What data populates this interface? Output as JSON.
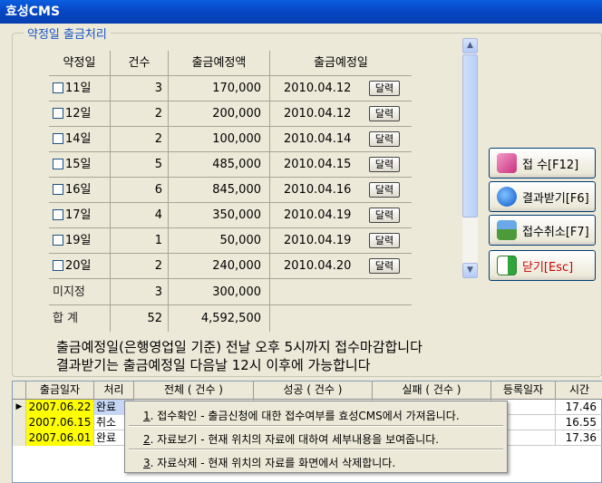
{
  "window": {
    "title": "효성CMS"
  },
  "group": {
    "title": "약정일 출금처리"
  },
  "grid": {
    "headers": [
      "약정일",
      "건수",
      "출금예정액",
      "출금예정일"
    ],
    "date_button_label": "달력",
    "rows": [
      {
        "day": "11일",
        "count": "3",
        "amount": "170,000",
        "date": "2010.04.12"
      },
      {
        "day": "12일",
        "count": "2",
        "amount": "200,000",
        "date": "2010.04.12"
      },
      {
        "day": "14일",
        "count": "2",
        "amount": "100,000",
        "date": "2010.04.14"
      },
      {
        "day": "15일",
        "count": "5",
        "amount": "485,000",
        "date": "2010.04.15"
      },
      {
        "day": "16일",
        "count": "6",
        "amount": "845,000",
        "date": "2010.04.16"
      },
      {
        "day": "17일",
        "count": "4",
        "amount": "350,000",
        "date": "2010.04.19"
      },
      {
        "day": "19일",
        "count": "1",
        "amount": "50,000",
        "date": "2010.04.19"
      },
      {
        "day": "20일",
        "count": "2",
        "amount": "240,000",
        "date": "2010.04.20"
      }
    ],
    "undesignated": {
      "label": "미지정",
      "count": "3",
      "amount": "300,000"
    },
    "total": {
      "label": "합 계",
      "count": "52",
      "amount": "4,592,500"
    }
  },
  "buttons": {
    "submit": "접 수[F12]",
    "receive": "결과받기[F6]",
    "cancel": "접수취소[F7]",
    "close": "닫기[Esc]"
  },
  "notes": [
    "출금예정일(은행영업일 기준) 전날 오후 5시까지 접수마감합니다",
    "결과받기는 출금예정일 다음날 12시 이후에 가능합니다"
  ],
  "bottom_table": {
    "headers": [
      "출금일자",
      "처리",
      "전체 ( 건수 )",
      "성공 ( 건수 )",
      "실패 ( 건수 )",
      "등록일자",
      "시간"
    ],
    "rows": [
      {
        "date": "2007.06.22",
        "status": "완료",
        "time": "17.46"
      },
      {
        "date": "2007.06.15",
        "status": "취소",
        "time": "16.55"
      },
      {
        "date": "2007.06.01",
        "status": "완료",
        "time": "17.36"
      }
    ]
  },
  "context_menu": {
    "items": [
      {
        "key": "1",
        "label": ". 접수확인 - 출금신청에 대한 접수여부를 효성CMS에서 가져옵니다."
      },
      {
        "key": "2",
        "label": ". 자료보기 - 현재 위치의 자료에 대하여 세부내용을 보여줍니다."
      },
      {
        "key": "3",
        "label": ". 자료삭제 - 현재 위치의 자료를 화면에서 삭제합니다."
      }
    ]
  },
  "colors": {
    "title_bar": "#0647c6",
    "legend_text": "#1b54c8",
    "date_highlight": "#ffff00",
    "close_label": "#cc0000"
  }
}
